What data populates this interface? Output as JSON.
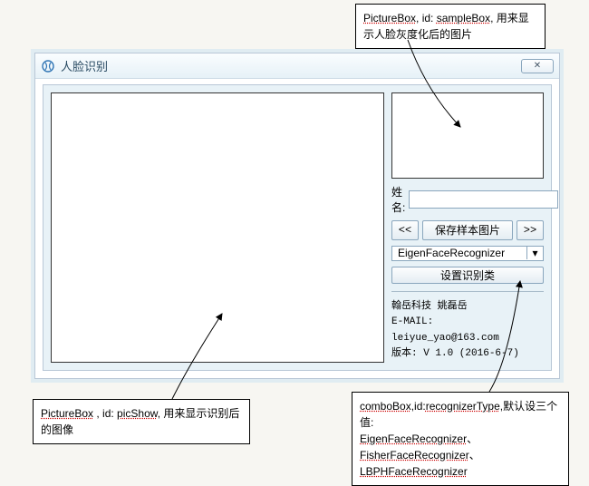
{
  "window": {
    "title": "人脸识别",
    "close_glyph": "✕"
  },
  "right": {
    "name_label": "姓名:",
    "name_value": "",
    "btn_prev": "<<",
    "btn_save": "保存样本图片",
    "btn_next": ">>",
    "combo_selected": "EigenFaceRecognizer",
    "combo_arrow": "▾",
    "btn_set": "设置识别类"
  },
  "info": {
    "line1": "翰岳科技  姚磊岳",
    "line2": "E-MAIL: leiyue_yao@163.com",
    "line3": "版本: V 1.0 (2016-6-7)"
  },
  "callouts": {
    "top": {
      "t1": "PictureBox",
      "t2": ", id: ",
      "t3": "sampleBox",
      "t4": ", 用来显示人脸灰度化后的图片"
    },
    "bottom_left": {
      "t1": "PictureBox",
      "t2": " , id: ",
      "t3": "picShow",
      "t4": ", 用来显示识别后的图像"
    },
    "bottom_right": {
      "t1": "comboBox",
      "t2": ",id:",
      "t3": "recognizerType",
      "t4": ",默认设三个值:",
      "v1": "EigenFaceRecognizer",
      "v2": "FisherFaceRecognizer",
      "v3": "LBPHFaceRecognizer",
      "sep": "、"
    }
  }
}
